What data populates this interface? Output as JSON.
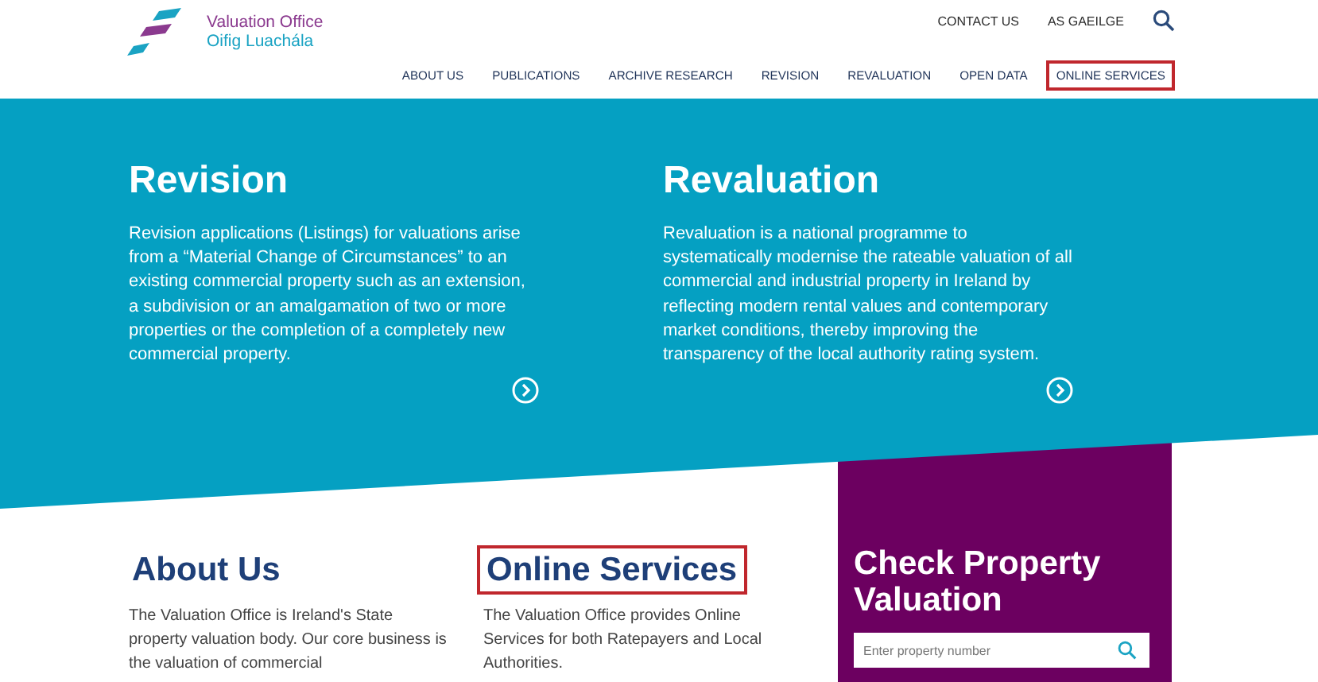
{
  "logo": {
    "name_en": "Valuation Office",
    "name_ga": "Oifig Luachála"
  },
  "top_links": [
    {
      "label": "CONTACT US"
    },
    {
      "label": "AS GAEILGE"
    }
  ],
  "nav": [
    {
      "label": "ABOUT US",
      "highlighted": false
    },
    {
      "label": "PUBLICATIONS",
      "highlighted": false
    },
    {
      "label": "ARCHIVE RESEARCH",
      "highlighted": false
    },
    {
      "label": "REVISION",
      "highlighted": false
    },
    {
      "label": "REVALUATION",
      "highlighted": false
    },
    {
      "label": "OPEN DATA",
      "highlighted": false
    },
    {
      "label": "ONLINE SERVICES",
      "highlighted": true
    }
  ],
  "hero_cards": [
    {
      "title": "Revision",
      "text": "Revision applications (Listings) for valuations arise from a “Material Change of Circumstances” to an existing commercial property such as an extension, a subdivision or an amalgamation of two or more properties or the completion of a completely new commercial property."
    },
    {
      "title": "Revaluation",
      "text": "Revaluation is a national programme to systematically modernise the rateable valuation of all commercial and industrial property in Ireland by reflecting modern rental values and contemporary market conditions, thereby improving the transparency of the local authority rating system."
    }
  ],
  "sections": [
    {
      "title": "About Us",
      "highlighted": false,
      "text": "The Valuation Office is Ireland's State property valuation body. Our core business is the valuation of commercial"
    },
    {
      "title": "Online Services",
      "highlighted": true,
      "text": "The Valuation Office provides Online Services for both Ratepayers and Local Authorities."
    }
  ],
  "check_panel": {
    "title": "Check Property Valuation",
    "search": {
      "placeholder": "Enter property number"
    }
  }
}
